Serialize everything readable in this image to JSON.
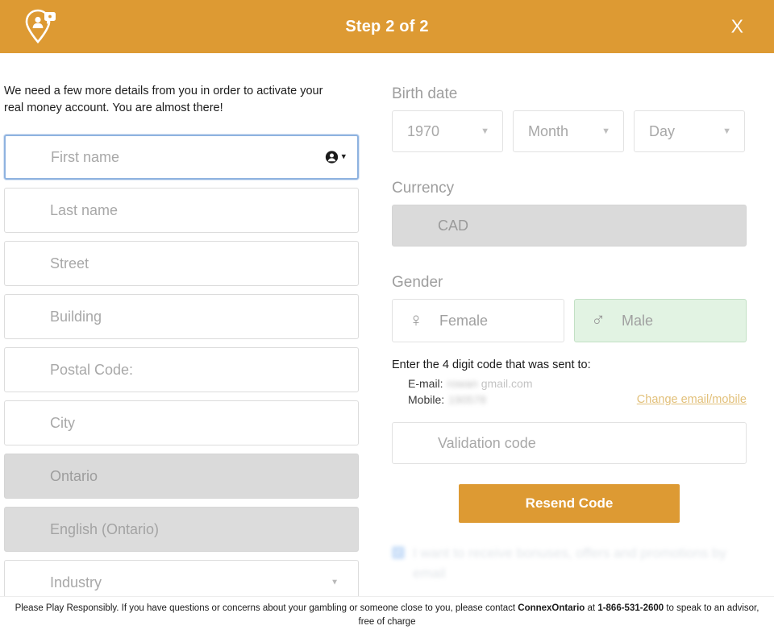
{
  "header": {
    "title": "Step 2 of 2",
    "close_label": "X",
    "logo_icon": "location-pin-person-icon",
    "accent_color": "#dd9a33"
  },
  "left": {
    "intro": "We need a few more details from you in order to activate your real money account. You are almost there!",
    "fields": [
      {
        "placeholder": "First name",
        "name": "first-name-input",
        "state": "focused",
        "icon": "autofill-person-icon"
      },
      {
        "placeholder": "Last name",
        "name": "last-name-input",
        "state": "normal"
      },
      {
        "placeholder": "Street",
        "name": "street-input",
        "state": "normal"
      },
      {
        "placeholder": "Building",
        "name": "building-input",
        "state": "normal"
      },
      {
        "placeholder": "Postal Code:",
        "name": "postal-code-input",
        "state": "normal"
      },
      {
        "placeholder": "City",
        "name": "city-input",
        "state": "normal"
      },
      {
        "placeholder": "Ontario",
        "name": "province-input",
        "state": "disabled"
      },
      {
        "placeholder": "English (Ontario)",
        "name": "language-input",
        "state": "disabled"
      },
      {
        "placeholder": "Industry",
        "name": "industry-select",
        "state": "dropdown"
      }
    ]
  },
  "right": {
    "birth_date_label": "Birth date",
    "birth_date": {
      "year": "1970",
      "month": "Month",
      "day": "Day"
    },
    "currency_label": "Currency",
    "currency_value": "CAD",
    "gender_label": "Gender",
    "gender_options": [
      {
        "label": "Female",
        "symbol": "♀",
        "selected": false
      },
      {
        "label": "Male",
        "symbol": "♂",
        "selected": true
      }
    ],
    "gender_selected_bg": "#e2f3e3",
    "code_note": "Enter the 4 digit code that was sent to:",
    "email_label": "E-mail:",
    "email_value": "rowan ",
    "email_value_tail": "gmail.com",
    "mobile_label": "Mobile:",
    "mobile_value": "190578",
    "change_link": "Change email/mobile",
    "validation_placeholder": "Validation code",
    "resend_label": "Resend Code",
    "promo_checked": true,
    "promo_text": "I want to receive bonuses, offers and promotions by email"
  },
  "footer": {
    "text_before": "Please Play Responsibly. If you have questions or concerns about your gambling or someone close to you, please contact ",
    "org": "ConnexOntario",
    "text_mid": " at ",
    "phone": "1-866-531-2600",
    "text_after": " to speak to an advisor, free of charge"
  }
}
